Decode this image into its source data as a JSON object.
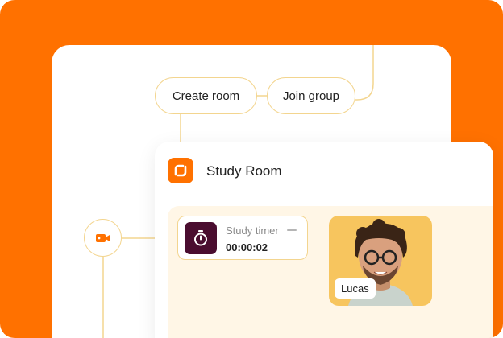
{
  "flow": {
    "create_room_label": "Create room",
    "join_group_label": "Join group",
    "video_icon": "video-camera-icon"
  },
  "room": {
    "title": "Study Room",
    "logo_icon": "brand-logo-icon",
    "timer": {
      "label": "Study timer",
      "value": "00:00:02",
      "icon": "stopwatch-icon"
    },
    "participant": {
      "name": "Lucas"
    }
  },
  "colors": {
    "background": "#FF7100",
    "accent": "#FF7100",
    "connector": "#F3D58F",
    "room_body": "#FFF6E6",
    "timer_icon_bg": "#4A0D2F",
    "video_tile_bg": "#F7C55E"
  }
}
